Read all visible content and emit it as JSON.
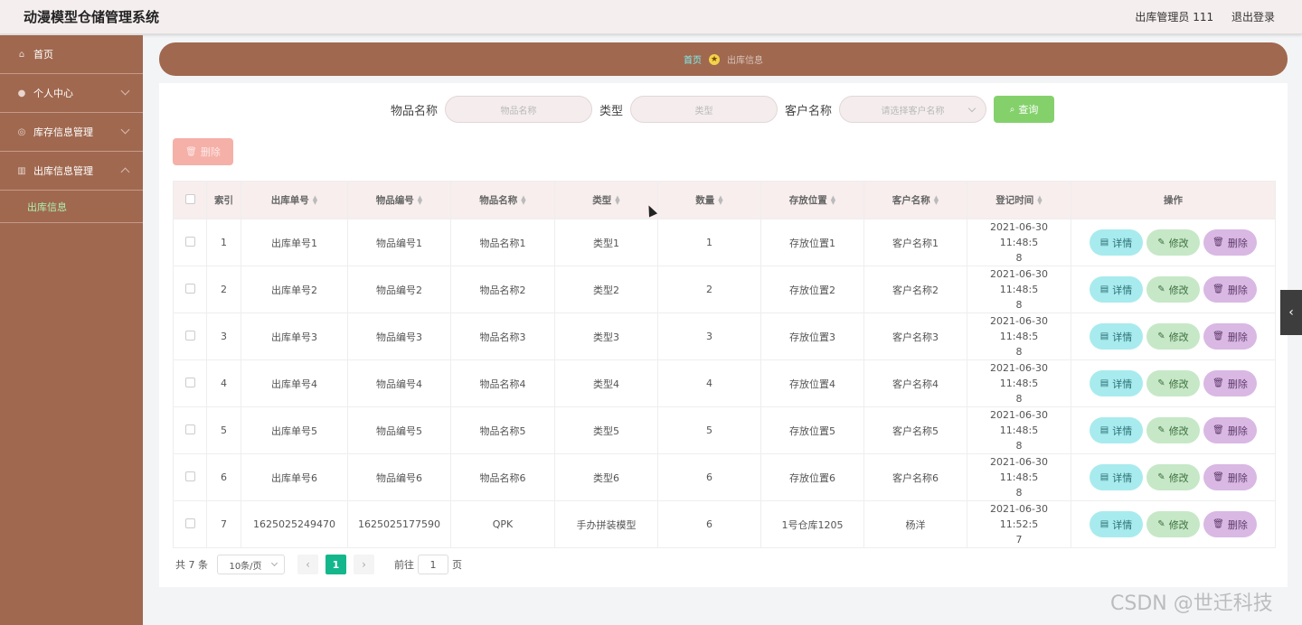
{
  "header": {
    "title": "动漫模型仓储管理系统",
    "user": "出库管理员 111",
    "logout": "退出登录"
  },
  "sidebar": {
    "items": [
      {
        "label": "首页",
        "icon": "home-icon"
      },
      {
        "label": "个人中心",
        "icon": "user-icon"
      },
      {
        "label": "库存信息管理",
        "icon": "compass-icon"
      },
      {
        "label": "出库信息管理",
        "icon": "bank-icon"
      }
    ],
    "sub_item": "出库信息"
  },
  "breadcrumb": {
    "home": "首页",
    "current": "出库信息"
  },
  "search": {
    "item_name_label": "物品名称",
    "item_name_placeholder": "物品名称",
    "type_label": "类型",
    "type_placeholder": "类型",
    "customer_label": "客户名称",
    "customer_placeholder": "请选择客户名称",
    "query_button": "查询"
  },
  "toolbar": {
    "delete_button": "删除"
  },
  "table": {
    "headers": [
      "索引",
      "出库单号",
      "物品编号",
      "物品名称",
      "类型",
      "数量",
      "存放位置",
      "客户名称",
      "登记时间",
      "操作"
    ],
    "rows": [
      {
        "index": "1",
        "order_no": "出库单号1",
        "item_no": "物品编号1",
        "item_name": "物品名称1",
        "type": "类型1",
        "qty": "1",
        "location": "存放位置1",
        "customer": "客户名称1",
        "time_a": "2021-06-30 11:48:5",
        "time_b": "8"
      },
      {
        "index": "2",
        "order_no": "出库单号2",
        "item_no": "物品编号2",
        "item_name": "物品名称2",
        "type": "类型2",
        "qty": "2",
        "location": "存放位置2",
        "customer": "客户名称2",
        "time_a": "2021-06-30 11:48:5",
        "time_b": "8"
      },
      {
        "index": "3",
        "order_no": "出库单号3",
        "item_no": "物品编号3",
        "item_name": "物品名称3",
        "type": "类型3",
        "qty": "3",
        "location": "存放位置3",
        "customer": "客户名称3",
        "time_a": "2021-06-30 11:48:5",
        "time_b": "8"
      },
      {
        "index": "4",
        "order_no": "出库单号4",
        "item_no": "物品编号4",
        "item_name": "物品名称4",
        "type": "类型4",
        "qty": "4",
        "location": "存放位置4",
        "customer": "客户名称4",
        "time_a": "2021-06-30 11:48:5",
        "time_b": "8"
      },
      {
        "index": "5",
        "order_no": "出库单号5",
        "item_no": "物品编号5",
        "item_name": "物品名称5",
        "type": "类型5",
        "qty": "5",
        "location": "存放位置5",
        "customer": "客户名称5",
        "time_a": "2021-06-30 11:48:5",
        "time_b": "8"
      },
      {
        "index": "6",
        "order_no": "出库单号6",
        "item_no": "物品编号6",
        "item_name": "物品名称6",
        "type": "类型6",
        "qty": "6",
        "location": "存放位置6",
        "customer": "客户名称6",
        "time_a": "2021-06-30 11:48:5",
        "time_b": "8"
      },
      {
        "index": "7",
        "order_no": "1625025249470",
        "item_no": "1625025177590",
        "item_name": "QPK",
        "type": "手办拼装模型",
        "qty": "6",
        "location": "1号仓库1205",
        "customer": "杨洋",
        "time_a": "2021-06-30 11:52:5",
        "time_b": "7"
      }
    ],
    "actions": {
      "detail": "详情",
      "edit": "修改",
      "delete": "删除"
    }
  },
  "pagination": {
    "total": "共 7 条",
    "page_size": "10条/页",
    "current_page": "1",
    "goto_label": "前往",
    "goto_value": "1",
    "page_suffix": "页"
  },
  "watermark": "CSDN @世迁科技",
  "colors": {
    "sidebar": "#a0684f",
    "query_button": "#84d16c",
    "active_page": "#14b78c",
    "detail_button": "#a8ebee",
    "edit_button": "#c6e8c7",
    "delete_button": "#d9b8e4"
  }
}
